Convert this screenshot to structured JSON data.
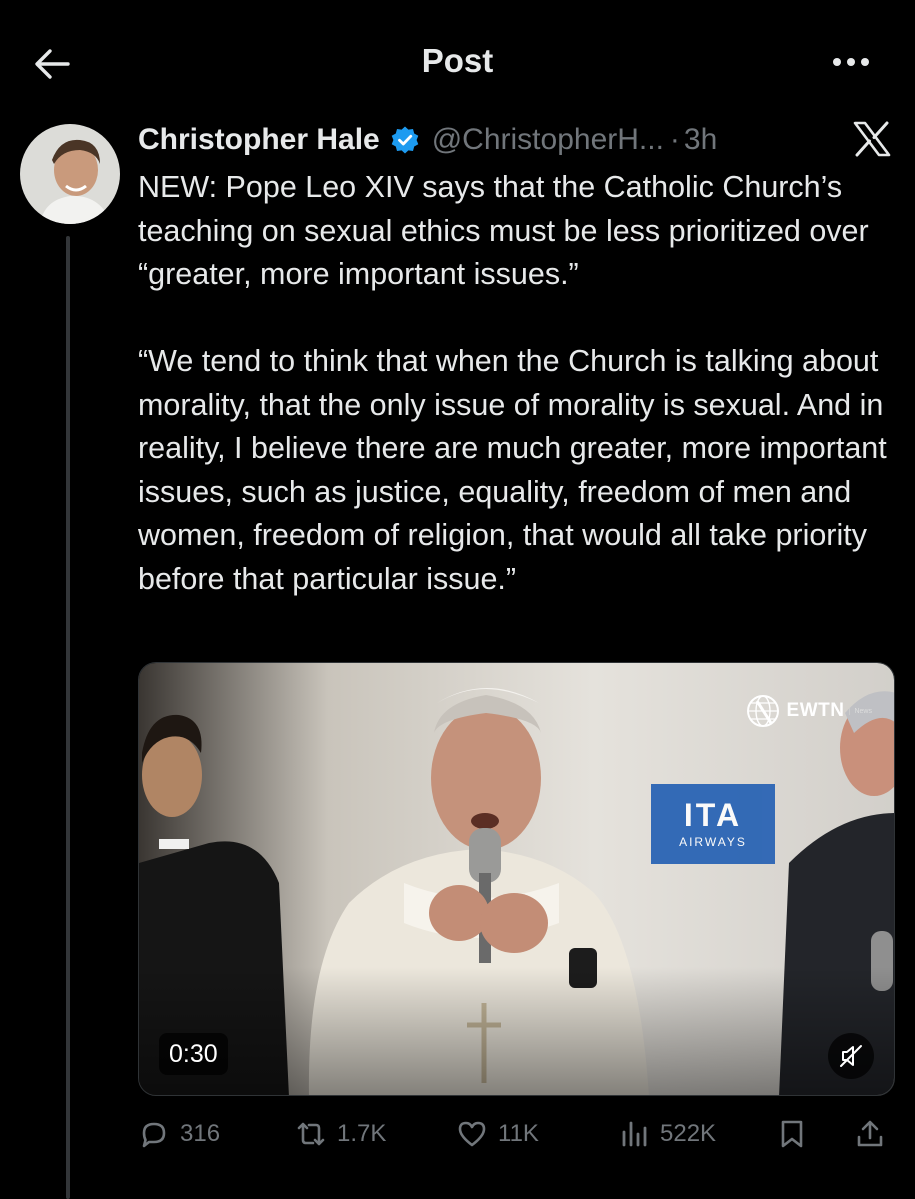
{
  "header": {
    "title": "Post",
    "back_icon": "arrow-left-icon",
    "more_icon": "more-horizontal-icon"
  },
  "post": {
    "author_name": "Christopher Hale",
    "handle": "@ChristopherH...",
    "separator": "·",
    "time": "3h",
    "verified_icon": "verified-badge-icon",
    "verified_color": "#1d9bf0",
    "platform_icon": "x-logo-icon",
    "text": "NEW: Pope Leo XIV says that the Catholic Church’s teaching on sexual ethics must be less prioritized over “greater, more important issues.”\n\n“We tend to think that when the Church is talking about morality, that the only issue of morality is sexual. And in reality, I believe there are much greater, more important issues, such as justice, equality, freedom of men and women, freedom of religion, that would all take priority before that particular issue.”"
  },
  "media": {
    "type": "video",
    "duration": "0:30",
    "watermark": "EWTN",
    "watermark_sub": "News",
    "banner_logo": "ITA",
    "banner_sub": "AIRWAYS",
    "mute_icon": "muted-speaker-icon"
  },
  "actions": {
    "replies": "316",
    "reposts": "1.7K",
    "likes": "11K",
    "views": "522K",
    "reply_icon": "reply-bubble-icon",
    "repost_icon": "repost-icon",
    "like_icon": "heart-icon",
    "views_icon": "bar-chart-icon",
    "bookmark_icon": "bookmark-icon",
    "share_icon": "share-icon"
  },
  "colors": {
    "background": "#000000",
    "text": "#e7e9ea",
    "secondary_text": "#71767b",
    "accent": "#1d9bf0"
  }
}
